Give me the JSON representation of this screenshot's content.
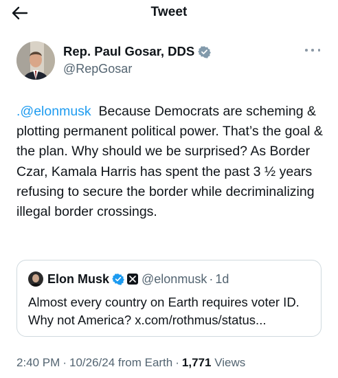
{
  "header": {
    "title": "Tweet",
    "back_icon": "arrow-left-icon"
  },
  "author": {
    "name": "Rep. Paul Gosar, DDS",
    "handle": "@RepGosar",
    "verified_color": "#829aab"
  },
  "tweet": {
    "mention": ".@elonmusk",
    "body": "Because Democrats are scheming & plotting permanent political power.  That’s the goal & the plan.  Why should we be surprised?  As Border Czar, Kamala Harris has spent the past 3 ½ years refusing to secure the border while decriminalizing illegal border crossings."
  },
  "quote": {
    "name": "Elon Musk",
    "handle": "@elonmusk",
    "dot": "·",
    "time": "1d",
    "text": "Almost every country on Earth requires voter ID. Why not America? x.com/rothmus/status...",
    "verified_color": "#1d9bf0"
  },
  "meta": {
    "time": "2:40 PM",
    "dot1": "·",
    "date": "10/26/24 from Earth",
    "dot2": "·",
    "views_count": "1,771",
    "views_label": "Views"
  },
  "colors": {
    "accent": "#1d9bf0",
    "text": "#0f1419",
    "secondary": "#536471",
    "border": "#cfd9de"
  }
}
